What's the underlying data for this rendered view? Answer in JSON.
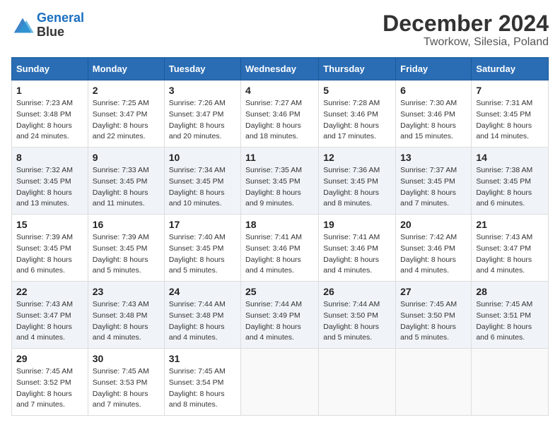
{
  "header": {
    "logo_line1": "General",
    "logo_line2": "Blue",
    "title": "December 2024",
    "subtitle": "Tworkow, Silesia, Poland"
  },
  "columns": [
    "Sunday",
    "Monday",
    "Tuesday",
    "Wednesday",
    "Thursday",
    "Friday",
    "Saturday"
  ],
  "weeks": [
    [
      {
        "day": "1",
        "sunrise": "Sunrise: 7:23 AM",
        "sunset": "Sunset: 3:48 PM",
        "daylight": "Daylight: 8 hours and 24 minutes."
      },
      {
        "day": "2",
        "sunrise": "Sunrise: 7:25 AM",
        "sunset": "Sunset: 3:47 PM",
        "daylight": "Daylight: 8 hours and 22 minutes."
      },
      {
        "day": "3",
        "sunrise": "Sunrise: 7:26 AM",
        "sunset": "Sunset: 3:47 PM",
        "daylight": "Daylight: 8 hours and 20 minutes."
      },
      {
        "day": "4",
        "sunrise": "Sunrise: 7:27 AM",
        "sunset": "Sunset: 3:46 PM",
        "daylight": "Daylight: 8 hours and 18 minutes."
      },
      {
        "day": "5",
        "sunrise": "Sunrise: 7:28 AM",
        "sunset": "Sunset: 3:46 PM",
        "daylight": "Daylight: 8 hours and 17 minutes."
      },
      {
        "day": "6",
        "sunrise": "Sunrise: 7:30 AM",
        "sunset": "Sunset: 3:46 PM",
        "daylight": "Daylight: 8 hours and 15 minutes."
      },
      {
        "day": "7",
        "sunrise": "Sunrise: 7:31 AM",
        "sunset": "Sunset: 3:45 PM",
        "daylight": "Daylight: 8 hours and 14 minutes."
      }
    ],
    [
      {
        "day": "8",
        "sunrise": "Sunrise: 7:32 AM",
        "sunset": "Sunset: 3:45 PM",
        "daylight": "Daylight: 8 hours and 13 minutes."
      },
      {
        "day": "9",
        "sunrise": "Sunrise: 7:33 AM",
        "sunset": "Sunset: 3:45 PM",
        "daylight": "Daylight: 8 hours and 11 minutes."
      },
      {
        "day": "10",
        "sunrise": "Sunrise: 7:34 AM",
        "sunset": "Sunset: 3:45 PM",
        "daylight": "Daylight: 8 hours and 10 minutes."
      },
      {
        "day": "11",
        "sunrise": "Sunrise: 7:35 AM",
        "sunset": "Sunset: 3:45 PM",
        "daylight": "Daylight: 8 hours and 9 minutes."
      },
      {
        "day": "12",
        "sunrise": "Sunrise: 7:36 AM",
        "sunset": "Sunset: 3:45 PM",
        "daylight": "Daylight: 8 hours and 8 minutes."
      },
      {
        "day": "13",
        "sunrise": "Sunrise: 7:37 AM",
        "sunset": "Sunset: 3:45 PM",
        "daylight": "Daylight: 8 hours and 7 minutes."
      },
      {
        "day": "14",
        "sunrise": "Sunrise: 7:38 AM",
        "sunset": "Sunset: 3:45 PM",
        "daylight": "Daylight: 8 hours and 6 minutes."
      }
    ],
    [
      {
        "day": "15",
        "sunrise": "Sunrise: 7:39 AM",
        "sunset": "Sunset: 3:45 PM",
        "daylight": "Daylight: 8 hours and 6 minutes."
      },
      {
        "day": "16",
        "sunrise": "Sunrise: 7:39 AM",
        "sunset": "Sunset: 3:45 PM",
        "daylight": "Daylight: 8 hours and 5 minutes."
      },
      {
        "day": "17",
        "sunrise": "Sunrise: 7:40 AM",
        "sunset": "Sunset: 3:45 PM",
        "daylight": "Daylight: 8 hours and 5 minutes."
      },
      {
        "day": "18",
        "sunrise": "Sunrise: 7:41 AM",
        "sunset": "Sunset: 3:46 PM",
        "daylight": "Daylight: 8 hours and 4 minutes."
      },
      {
        "day": "19",
        "sunrise": "Sunrise: 7:41 AM",
        "sunset": "Sunset: 3:46 PM",
        "daylight": "Daylight: 8 hours and 4 minutes."
      },
      {
        "day": "20",
        "sunrise": "Sunrise: 7:42 AM",
        "sunset": "Sunset: 3:46 PM",
        "daylight": "Daylight: 8 hours and 4 minutes."
      },
      {
        "day": "21",
        "sunrise": "Sunrise: 7:43 AM",
        "sunset": "Sunset: 3:47 PM",
        "daylight": "Daylight: 8 hours and 4 minutes."
      }
    ],
    [
      {
        "day": "22",
        "sunrise": "Sunrise: 7:43 AM",
        "sunset": "Sunset: 3:47 PM",
        "daylight": "Daylight: 8 hours and 4 minutes."
      },
      {
        "day": "23",
        "sunrise": "Sunrise: 7:43 AM",
        "sunset": "Sunset: 3:48 PM",
        "daylight": "Daylight: 8 hours and 4 minutes."
      },
      {
        "day": "24",
        "sunrise": "Sunrise: 7:44 AM",
        "sunset": "Sunset: 3:48 PM",
        "daylight": "Daylight: 8 hours and 4 minutes."
      },
      {
        "day": "25",
        "sunrise": "Sunrise: 7:44 AM",
        "sunset": "Sunset: 3:49 PM",
        "daylight": "Daylight: 8 hours and 4 minutes."
      },
      {
        "day": "26",
        "sunrise": "Sunrise: 7:44 AM",
        "sunset": "Sunset: 3:50 PM",
        "daylight": "Daylight: 8 hours and 5 minutes."
      },
      {
        "day": "27",
        "sunrise": "Sunrise: 7:45 AM",
        "sunset": "Sunset: 3:50 PM",
        "daylight": "Daylight: 8 hours and 5 minutes."
      },
      {
        "day": "28",
        "sunrise": "Sunrise: 7:45 AM",
        "sunset": "Sunset: 3:51 PM",
        "daylight": "Daylight: 8 hours and 6 minutes."
      }
    ],
    [
      {
        "day": "29",
        "sunrise": "Sunrise: 7:45 AM",
        "sunset": "Sunset: 3:52 PM",
        "daylight": "Daylight: 8 hours and 7 minutes."
      },
      {
        "day": "30",
        "sunrise": "Sunrise: 7:45 AM",
        "sunset": "Sunset: 3:53 PM",
        "daylight": "Daylight: 8 hours and 7 minutes."
      },
      {
        "day": "31",
        "sunrise": "Sunrise: 7:45 AM",
        "sunset": "Sunset: 3:54 PM",
        "daylight": "Daylight: 8 hours and 8 minutes."
      },
      null,
      null,
      null,
      null
    ]
  ]
}
